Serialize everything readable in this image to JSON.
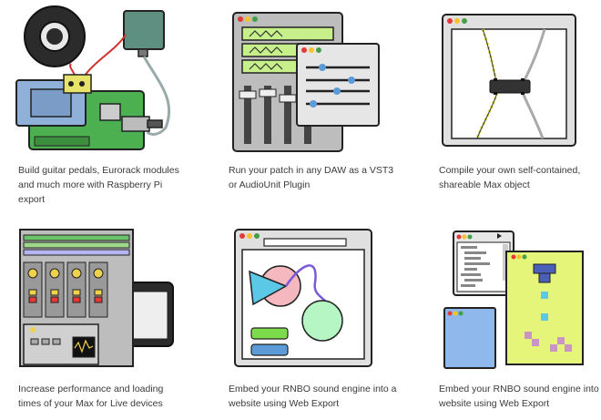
{
  "features": [
    {
      "id": "raspberry-pi",
      "lines": [
        "Build guitar pedals, Eurorack modules",
        "and much more with Raspberry Pi",
        "export"
      ],
      "icon": "raspberry-pi-board-icon"
    },
    {
      "id": "daw-plugin",
      "lines": [
        "Run your patch in any DAW as a VST3",
        "or AudioUnit Plugin"
      ],
      "icon": "daw-plugin-window-icon"
    },
    {
      "id": "max-external",
      "lines": [
        "Compile your own self-contained,",
        "shareable Max object"
      ],
      "icon": "max-object-window-icon"
    },
    {
      "id": "max-for-live",
      "lines": [
        "Increase performance and loading",
        "times of your Max for Live devices"
      ],
      "icon": "live-device-window-icon"
    },
    {
      "id": "web-export-1",
      "lines": [
        "Embed your RNBO sound engine into a",
        "website using Web Export"
      ],
      "icon": "web-browser-shapes-icon"
    },
    {
      "id": "web-export-2",
      "lines": [
        "Embed your RNBO sound engine into a",
        "website using Web Export"
      ],
      "icon": "web-code-windows-icon"
    }
  ],
  "colors": {
    "outline": "#222222",
    "board_green": "#4caf50",
    "pi_blue": "#8fb0d8",
    "module_teal": "#5f8f80",
    "window_gray": "#d8d8d8",
    "screen_green": "#c8f08a",
    "accent_blue": "#5a9bd8",
    "pink": "#f5b8bf",
    "mint": "#b6f5c4",
    "yellow_green": "#e4f57a",
    "purple": "#c995c2"
  }
}
